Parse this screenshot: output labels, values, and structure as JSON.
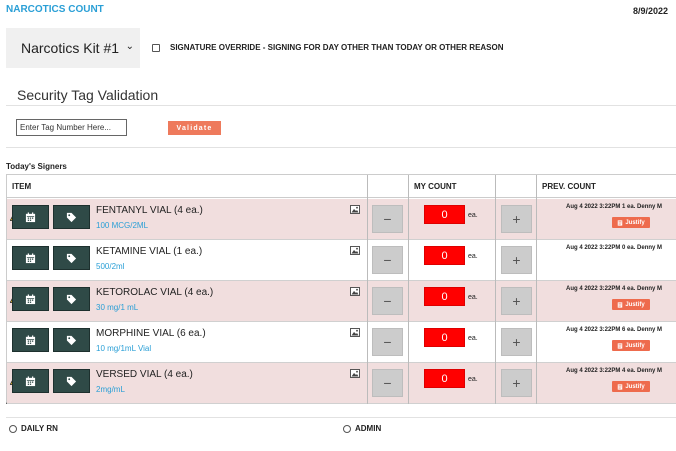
{
  "app": {
    "title": "NARCOTICS COUNT",
    "date": "8/9/2022"
  },
  "kit_select": {
    "value": "Narcotics Kit #1"
  },
  "override": {
    "label": "SIGNATURE OVERRIDE - SIGNING FOR DAY OTHER THAN TODAY OR OTHER REASON",
    "checked": false
  },
  "security": {
    "title": "Security Tag Validation",
    "placeholder": "Enter Tag Number Here...",
    "validate_label": "Validate"
  },
  "signers": {
    "label": "Today's Signers"
  },
  "table": {
    "headers": {
      "item": "ITEM",
      "my_count": "MY COUNT",
      "prev_count": "PREV. COUNT"
    },
    "rows": [
      {
        "name": "FENTANYL VIAL (4 ea.)",
        "conc": "100 MCG/2ML",
        "count": "0",
        "unit": "ea.",
        "prev": "Aug 4 2022 3:22PM  1 ea. Denny M",
        "warning": true,
        "justify": "Justify"
      },
      {
        "name": "KETAMINE VIAL (1 ea.)",
        "conc": "500/2ml",
        "count": "0",
        "unit": "ea.",
        "prev": "Aug 4 2022 3:22PM  0 ea. Denny M",
        "warning": false,
        "justify": ""
      },
      {
        "name": "KETOROLAC VIAL (4 ea.)",
        "conc": "30 mg/1 mL",
        "count": "0",
        "unit": "ea.",
        "prev": "Aug 4 2022 3:22PM  4 ea. Denny M",
        "warning": true,
        "justify": "Justify"
      },
      {
        "name": "MORPHINE VIAL (6 ea.)",
        "conc": "10 mg/1mL Vial",
        "count": "0",
        "unit": "ea.",
        "prev": "Aug 4 2022 3:22PM  6 ea. Denny M",
        "warning": false,
        "justify": "Justify"
      },
      {
        "name": "VERSED VIAL (4 ea.)",
        "conc": "2mg/mL",
        "count": "0",
        "unit": "ea.",
        "prev": "Aug 4 2022 3:22PM  4 ea. Denny M",
        "warning": true,
        "justify": "Justify"
      }
    ]
  },
  "controls": {
    "minus": "−",
    "plus": "+"
  },
  "footer": {
    "daily_rn": "DAILY RN",
    "admin": "ADMIN"
  },
  "colors": {
    "accent": "#2a9fd6",
    "count_red": "#ff0000",
    "row_pink": "#f1dede",
    "dark_button": "#2f4a47",
    "validate": "#ee7a5c"
  }
}
